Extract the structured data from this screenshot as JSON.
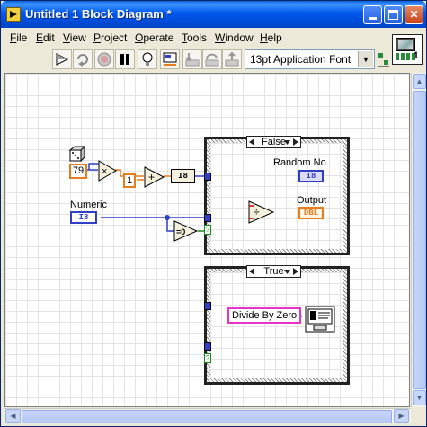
{
  "window": {
    "title": "Untitled 1 Block Diagram *",
    "controls": {
      "minimize": "",
      "maximize": "",
      "close": "✕"
    }
  },
  "menu": [
    {
      "label": "File",
      "mnemonic": "F",
      "rest": "ile"
    },
    {
      "label": "Edit",
      "mnemonic": "E",
      "rest": "dit"
    },
    {
      "label": "View",
      "mnemonic": "V",
      "rest": "iew"
    },
    {
      "label": "Project",
      "mnemonic": "P",
      "rest": "roject"
    },
    {
      "label": "Operate",
      "mnemonic": "O",
      "rest": "perate"
    },
    {
      "label": "Tools",
      "mnemonic": "T",
      "rest": "ools"
    },
    {
      "label": "Window",
      "mnemonic": "W",
      "rest": "indow"
    },
    {
      "label": "Help",
      "mnemonic": "H",
      "rest": "elp"
    }
  ],
  "corner_icon": {
    "digit": "1"
  },
  "toolbar": {
    "tools": [
      "run-icon",
      "run-continuously-icon",
      "abort-icon",
      "pause-icon",
      "highlight-execution-icon",
      "retain-wire-values-icon",
      "step-into-icon",
      "step-over-icon",
      "step-out-icon"
    ],
    "font": "13pt Application Font"
  },
  "diagram": {
    "constant_79": "79",
    "constant_1": "1",
    "multiply_symbol": "×",
    "add_symbol": "+",
    "convert_label": "I8",
    "numeric_label": "Numeric",
    "numeric_type": "I8",
    "equal_zero": "=0",
    "random_no_label": "Random No",
    "random_no_type": "I8",
    "output_label": "Output",
    "output_type": "DBL",
    "divide_symbol": "÷",
    "case_false_label": "False",
    "case_true_label": "True",
    "divide_by_zero_text": "Divide By Zero",
    "bool_tunnel_mark": "?"
  },
  "colors": {
    "integer_wire": "#2f3fc6",
    "float_wire": "#e87b1b",
    "boolean_wire": "#1a8a1a",
    "string_wire": "#e535c8",
    "titlebar": "#0058ee"
  }
}
